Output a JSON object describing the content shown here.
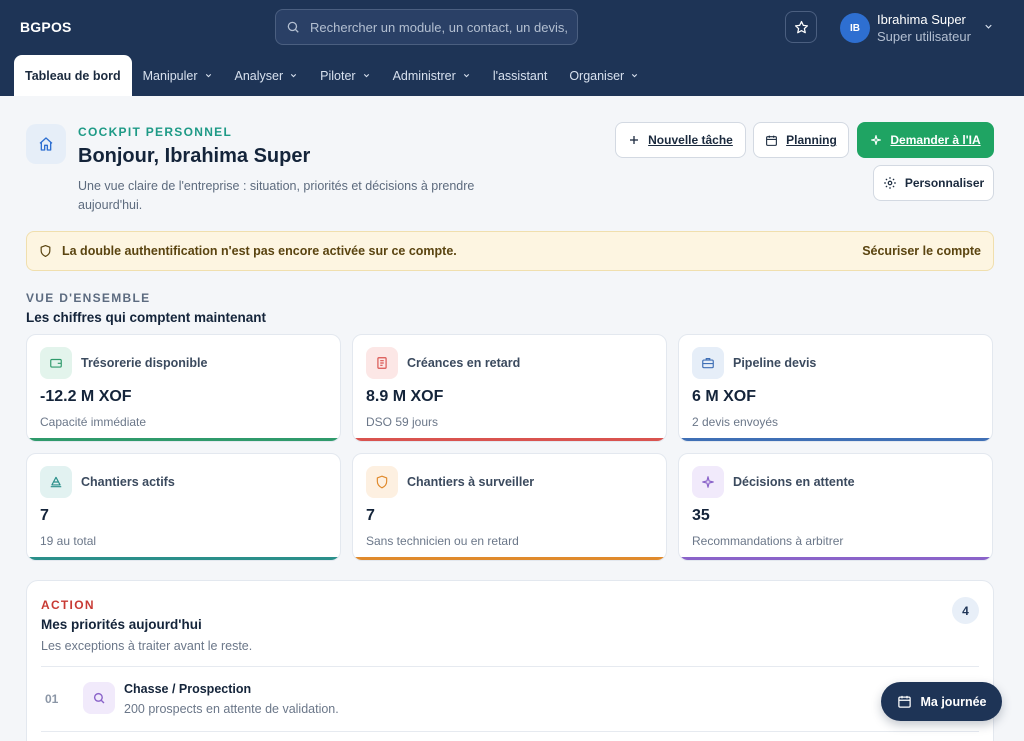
{
  "app": {
    "brand": "BGPOS"
  },
  "search": {
    "placeholder": "Rechercher un module, un contact, un devis, un"
  },
  "user": {
    "initials": "IB",
    "name": "Ibrahima Super",
    "role": "Super utilisateur"
  },
  "nav": [
    {
      "label": "Tableau de bord",
      "active": true,
      "dropdown": false
    },
    {
      "label": "Manipuler",
      "dropdown": true
    },
    {
      "label": "Analyser",
      "dropdown": true
    },
    {
      "label": "Piloter",
      "dropdown": true
    },
    {
      "label": "Administrer",
      "dropdown": true
    },
    {
      "label": "l'assistant",
      "dropdown": false
    },
    {
      "label": "Organiser",
      "dropdown": true
    }
  ],
  "header": {
    "eyebrow": "COCKPIT PERSONNEL",
    "greeting": "Bonjour, Ibrahima Super",
    "subtitle": "Une vue claire de l'entreprise : situation, priorités et décisions à prendre aujourd'hui."
  },
  "actions": {
    "new_task": "Nouvelle tâche",
    "planning": "Planning",
    "ask_ai": "Demander à l'IA",
    "customize": "Personnaliser"
  },
  "alert": {
    "text": "La double authentification n'est pas encore activée sur ce compte.",
    "link": "Sécuriser le compte"
  },
  "overview": {
    "eyebrow": "VUE D'ENSEMBLE",
    "title": "Les chiffres qui comptent maintenant",
    "cards": [
      {
        "label": "Trésorerie disponible",
        "value": "-12.2 M XOF",
        "hint": "Capacité immédiate",
        "icon": "wallet-icon",
        "accent": "#2f9a6b",
        "tint": "#e3f4ec"
      },
      {
        "label": "Créances en retard",
        "value": "8.9 M XOF",
        "hint": "DSO 59 jours",
        "icon": "receipt-icon",
        "accent": "#d9534f",
        "tint": "#fce7e6"
      },
      {
        "label": "Pipeline devis",
        "value": "6 M XOF",
        "hint": "2 devis envoyés",
        "icon": "briefcase-icon",
        "accent": "#3f6fb5",
        "tint": "#e6eef8"
      },
      {
        "label": "Chantiers actifs",
        "value": "7",
        "hint": "19 au total",
        "icon": "construction-icon",
        "accent": "#2a8f8a",
        "tint": "#e2f2f1"
      },
      {
        "label": "Chantiers à surveiller",
        "value": "7",
        "hint": "Sans technicien ou en retard",
        "icon": "shield-icon",
        "accent": "#e08a2c",
        "tint": "#fdf0e1"
      },
      {
        "label": "Décisions en attente",
        "value": "35",
        "hint": "Recommandations à arbitrer",
        "icon": "sparkle-icon",
        "accent": "#8a63c9",
        "tint": "#f1eafb"
      }
    ]
  },
  "priorities": {
    "eyebrow": "ACTION",
    "title": "Mes priorités aujourd'hui",
    "subtitle": "Les exceptions à traiter avant le reste.",
    "count": "4",
    "items": [
      {
        "num": "01",
        "title": "Chasse / Prospection",
        "desc": "200 prospects en attente de validation.",
        "icon": "search-icon"
      }
    ]
  },
  "fab": {
    "label": "Ma journée"
  }
}
